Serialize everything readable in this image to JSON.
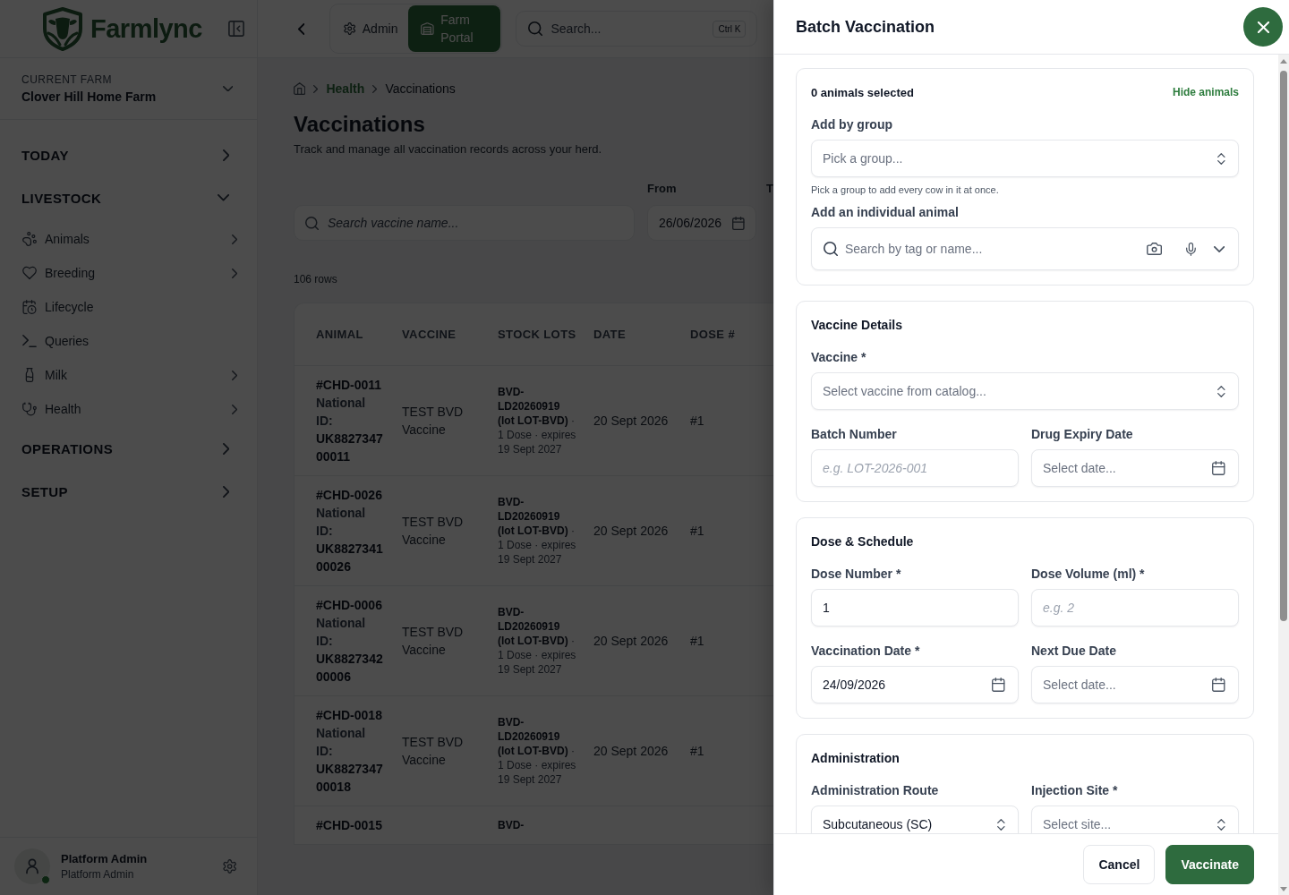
{
  "sidebar": {
    "brand": "Farmlync",
    "farm": {
      "caption": "CURRENT FARM",
      "name": "Clover Hill Home Farm"
    },
    "nav": [
      {
        "label": "TODAY",
        "expanded": false
      },
      {
        "label": "LIVESTOCK",
        "expanded": true,
        "children": [
          {
            "label": "Animals",
            "has_submenu": true
          },
          {
            "label": "Breeding",
            "has_submenu": true
          },
          {
            "label": "Lifecycle",
            "has_submenu": false
          },
          {
            "label": "Queries",
            "has_submenu": false
          },
          {
            "label": "Milk",
            "has_submenu": true
          },
          {
            "label": "Health",
            "has_submenu": true
          }
        ]
      },
      {
        "label": "OPERATIONS",
        "expanded": false
      },
      {
        "label": "SETUP",
        "expanded": false
      }
    ],
    "user": {
      "name": "Platform Admin",
      "role": "Platform Admin",
      "online": true
    }
  },
  "topbar": {
    "tabs": [
      {
        "label": "Admin",
        "selected": false
      },
      {
        "label": "Farm Portal",
        "selected": true
      }
    ],
    "search": {
      "placeholder": "Search...",
      "shortcut": "Ctrl K"
    }
  },
  "page": {
    "breadcrumb": [
      "Health",
      "Vaccinations"
    ],
    "title": "Vaccinations",
    "subtitle": "Track and manage all vaccination records across your herd.",
    "filters": {
      "search": {
        "placeholder": "Search vaccine name..."
      },
      "from": {
        "label": "From",
        "value": "26/06/2026"
      },
      "to": {
        "label": "T"
      }
    },
    "row_count": "106 rows",
    "table": {
      "columns": [
        "ANIMAL",
        "VACCINE",
        "STOCK LOTS",
        "DATE",
        "DOSE #"
      ],
      "rows": [
        {
          "tag": "#CHD-0011",
          "id_label": "National ID:",
          "national_id": "UK882734700011",
          "vaccine": "TEST BVD Vaccine",
          "lot": "BVD-LD20260919 (lot LOT-BVD)",
          "lot_detail": "· 1 Dose · expires 19 Sept 2027",
          "date": "20 Sept 2026",
          "dose": "#1"
        },
        {
          "tag": "#CHD-0026",
          "id_label": "National ID:",
          "national_id": "UK882734100026",
          "vaccine": "TEST BVD Vaccine",
          "lot": "BVD-LD20260919 (lot LOT-BVD)",
          "lot_detail": "· 1 Dose · expires 19 Sept 2027",
          "date": "20 Sept 2026",
          "dose": "#1"
        },
        {
          "tag": "#CHD-0006",
          "id_label": "National ID:",
          "national_id": "UK882734200006",
          "vaccine": "TEST BVD Vaccine",
          "lot": "BVD-LD20260919 (lot LOT-BVD)",
          "lot_detail": "· 1 Dose · expires 19 Sept 2027",
          "date": "20 Sept 2026",
          "dose": "#1"
        },
        {
          "tag": "#CHD-0018",
          "id_label": "National ID:",
          "national_id": "UK882734700018",
          "vaccine": "TEST BVD Vaccine",
          "lot": "BVD-LD20260919 (lot LOT-BVD)",
          "lot_detail": "· 1 Dose · expires 19 Sept 2027",
          "date": "20 Sept 2026",
          "dose": "#1"
        },
        {
          "tag": "#CHD-0015",
          "lot": "BVD-"
        }
      ]
    }
  },
  "drawer": {
    "title": "Batch Vaccination",
    "animals": {
      "count": "0 animals selected",
      "toggle": "Hide animals",
      "group_label": "Add by group",
      "group_select": {
        "placeholder": "Pick a group..."
      },
      "group_hint": "Pick a group to add every cow in it at once.",
      "individual_label": "Add an individual animal",
      "individual_search": {
        "placeholder": "Search by tag or name..."
      }
    },
    "sections": [
      {
        "title": "Vaccine Details",
        "rows": [
          [
            {
              "label": "Vaccine *",
              "kind": "select",
              "placeholder": "Select vaccine from catalog..."
            }
          ],
          [
            {
              "label": "Batch Number",
              "kind": "text",
              "placeholder": "e.g. LOT-2026-001"
            },
            {
              "label": "Drug Expiry Date",
              "kind": "date",
              "placeholder": "Select date..."
            }
          ]
        ]
      },
      {
        "title": "Dose & Schedule",
        "rows": [
          [
            {
              "label": "Dose Number *",
              "kind": "text",
              "value": "1"
            },
            {
              "label": "Dose Volume (ml) *",
              "kind": "text",
              "placeholder": "e.g. 2"
            }
          ],
          [
            {
              "label": "Vaccination Date *",
              "kind": "date",
              "value": "24/09/2026"
            },
            {
              "label": "Next Due Date",
              "kind": "date",
              "placeholder": "Select date..."
            }
          ]
        ]
      },
      {
        "title": "Administration",
        "rows": [
          [
            {
              "label": "Administration Route",
              "kind": "select",
              "value": "Subcutaneous (SC)"
            },
            {
              "label": "Injection Site *",
              "kind": "select",
              "placeholder": "Select site..."
            }
          ]
        ]
      }
    ],
    "actions": [
      {
        "label": "Cancel",
        "kind": "secondary"
      },
      {
        "label": "Vaccinate",
        "kind": "primary"
      }
    ]
  }
}
